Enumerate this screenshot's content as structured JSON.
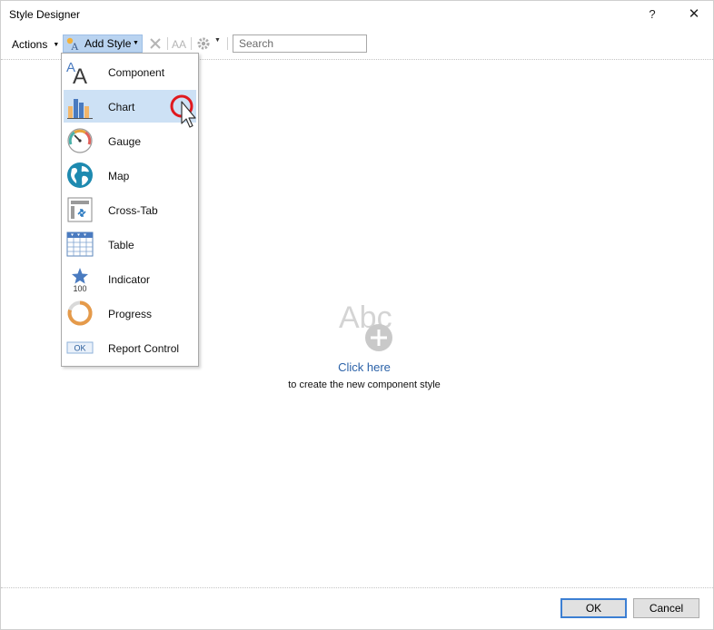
{
  "window": {
    "title": "Style Designer",
    "help_label": "?",
    "close_label": "✕"
  },
  "toolbar": {
    "actions_label": "Actions",
    "add_style_label": "Add Style",
    "search": {
      "value": "",
      "placeholder": "Search"
    }
  },
  "menu": {
    "items": [
      {
        "label": "Component",
        "icon": "component-icon"
      },
      {
        "label": "Chart",
        "icon": "chart-icon",
        "active": true
      },
      {
        "label": "Gauge",
        "icon": "gauge-icon"
      },
      {
        "label": "Map",
        "icon": "map-icon"
      },
      {
        "label": "Cross-Tab",
        "icon": "cross-tab-icon"
      },
      {
        "label": "Table",
        "icon": "table-icon"
      },
      {
        "label": "Indicator",
        "icon": "indicator-icon",
        "icon_text": "100"
      },
      {
        "label": "Progress",
        "icon": "progress-icon"
      },
      {
        "label": "Report Control",
        "icon": "report-control-icon",
        "icon_text": "OK"
      }
    ]
  },
  "empty_state": {
    "icon_text": "Abc",
    "link_text": "Click here",
    "sub_text": "to create the new component style"
  },
  "footer": {
    "ok_label": "OK",
    "cancel_label": "Cancel"
  },
  "colors": {
    "accent": "#3c7fd3",
    "menu_highlight": "#cde1f5",
    "link": "#2b62a8",
    "cursor_ring": "#e0191f"
  }
}
